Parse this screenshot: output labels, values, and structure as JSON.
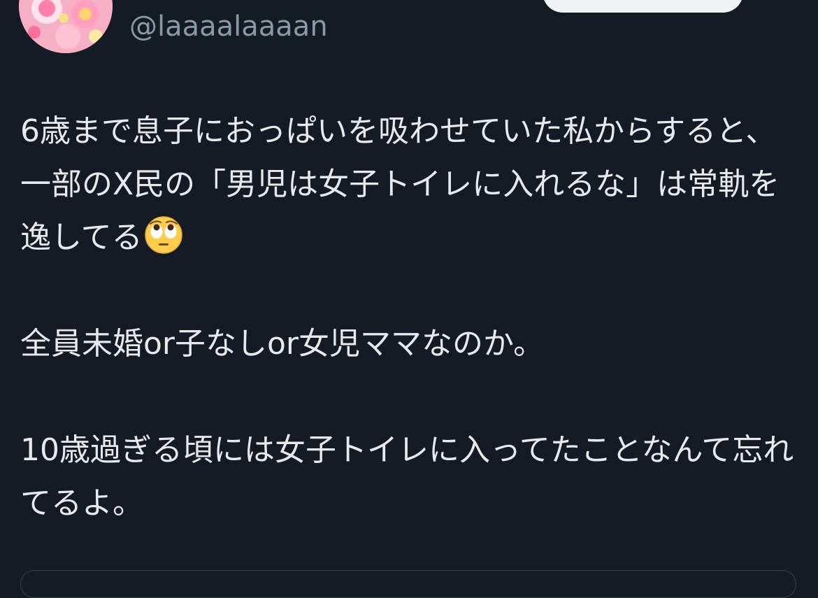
{
  "profile": {
    "handle": "@laaaalaaaan",
    "avatar_icon": "floral-avatar"
  },
  "tweet": {
    "paragraphs": [
      "6歳まで息子におっぱいを吸わせていた私からすると、一部のX民の「男児は女子トイレに入れるな」は常軌を逸してる",
      "全員未婚or子なしor女児ママなのか。",
      "10歳過ぎる頃には女子トイレに入ってたことなんて忘れてるよ。"
    ],
    "emoji": "face-with-rolling-eyes"
  },
  "colors": {
    "background": "#151b24",
    "text": "#e7e9ea",
    "secondary_text": "#8b98a5",
    "button": "#eff3f4"
  }
}
